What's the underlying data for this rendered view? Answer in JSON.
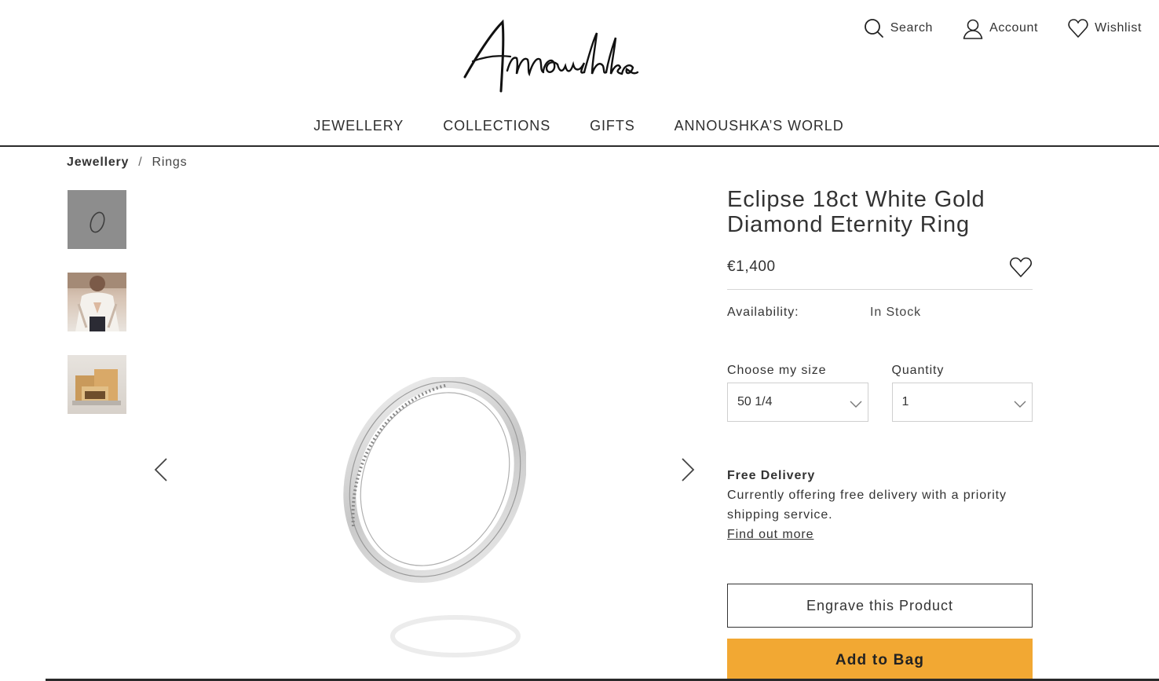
{
  "brand": {
    "logo_text": "Annoushka"
  },
  "utility_nav": {
    "search_label": "Search",
    "account_label": "Account",
    "wishlist_label": "Wishlist"
  },
  "main_nav": {
    "items": [
      {
        "label": "JEWELLERY"
      },
      {
        "label": "COLLECTIONS"
      },
      {
        "label": "GIFTS"
      },
      {
        "label": "ANNOUSHKA’S WORLD"
      }
    ]
  },
  "breadcrumb": {
    "first": "Jewellery",
    "separator": "/",
    "current": "Rings"
  },
  "gallery": {
    "icons": {
      "prev": "chevron-left-icon",
      "next": "chevron-right-icon"
    }
  },
  "product": {
    "title": "Eclipse 18ct White Gold Diamond Eternity Ring",
    "price": "€1,400",
    "availability_label": "Availability:",
    "availability_value": "In Stock",
    "size_label": "Choose my size",
    "size_value": "50 1/4",
    "quantity_label": "Quantity",
    "quantity_value": "1",
    "delivery_title": "Free Delivery",
    "delivery_text": "Currently offering free delivery with a priority shipping service.",
    "delivery_link": "Find out more",
    "engrave_label": "Engrave this Product",
    "add_to_bag_label": "Add to Bag"
  },
  "colors": {
    "accent": "#f2a833",
    "text": "#2b2b2b",
    "border": "#cfcfcf"
  }
}
